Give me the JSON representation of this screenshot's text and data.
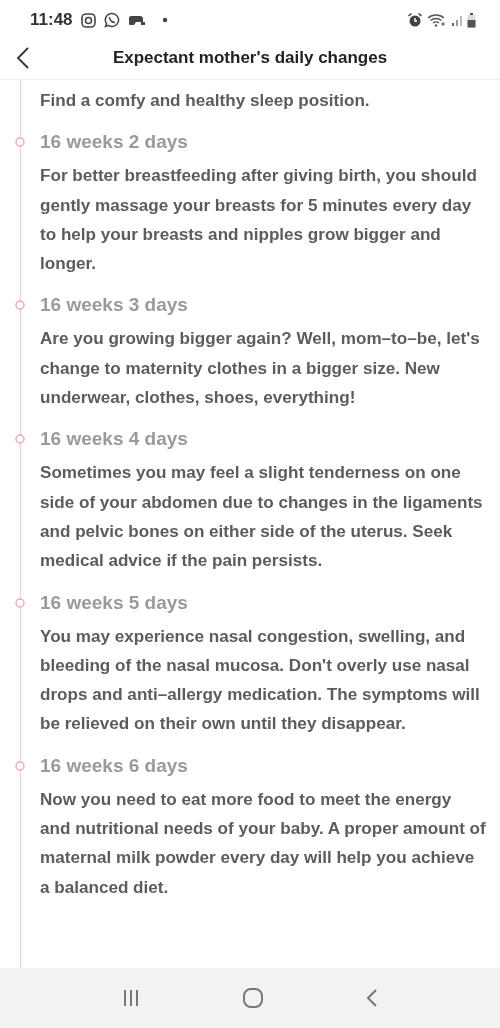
{
  "status_bar": {
    "time": "11:48"
  },
  "header": {
    "title": "Expectant mother's daily changes"
  },
  "lead_text": "Find a comfy and healthy sleep position.",
  "entries": [
    {
      "title": "16 weeks 2 days",
      "text": "For better breastfeeding after giving birth, you should gently massage your breasts for 5 minutes every day to help your breasts and nipples grow bigger and longer."
    },
    {
      "title": "16 weeks 3 days",
      "text": "Are you growing bigger again? Well, mom–to–be, let's change to maternity clothes in a bigger size. New underwear, clothes, shoes, everything!"
    },
    {
      "title": "16 weeks 4 days",
      "text": "Sometimes you may feel a slight tenderness on one side of your abdomen due to changes in the ligaments and pelvic bones on either side of the uterus. Seek medical advice if the pain persists."
    },
    {
      "title": "16 weeks 5 days",
      "text": "You may experience nasal congestion, swelling, and bleeding of the nasal mucosa. Don't overly use nasal drops and anti–allergy medication. The symptoms will be relieved on their own until they disappear."
    },
    {
      "title": "16 weeks 6 days",
      "text": "Now you need to eat more food to meet the energy and nutritional needs of your baby. A proper amount of maternal milk powder every day will help you achieve a balanced diet."
    }
  ]
}
